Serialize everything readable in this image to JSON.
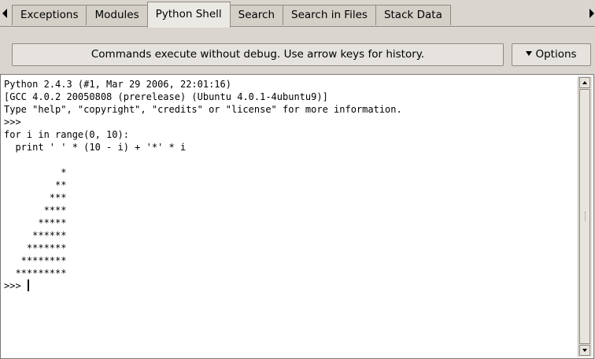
{
  "tabs": [
    {
      "label": "Exceptions"
    },
    {
      "label": "Modules"
    },
    {
      "label": "Python Shell"
    },
    {
      "label": "Search"
    },
    {
      "label": "Search in Files"
    },
    {
      "label": "Stack Data"
    }
  ],
  "active_tab": "Python Shell",
  "commandbar": {
    "info": "Commands execute without debug.  Use arrow keys for history.",
    "options_label": "Options"
  },
  "shell": {
    "lines": [
      "Python 2.4.3 (#1, Mar 29 2006, 22:01:16)",
      "[GCC 4.0.2 20050808 (prerelease) (Ubuntu 4.0.1-4ubuntu9)]",
      "Type \"help\", \"copyright\", \"credits\" or \"license\" for more information.",
      ">>>",
      "for i in range(0, 10):",
      "  print ' ' * (10 - i) + '*' * i",
      "",
      "          *",
      "         **",
      "        ***",
      "       ****",
      "      *****",
      "     ******",
      "    *******",
      "   ********",
      "  *********"
    ],
    "prompt": ">>> "
  },
  "icons": {
    "tab_scroll_left": "triangle-left-icon",
    "tab_scroll_right": "triangle-right-icon",
    "options_caret": "chevron-down-icon"
  }
}
